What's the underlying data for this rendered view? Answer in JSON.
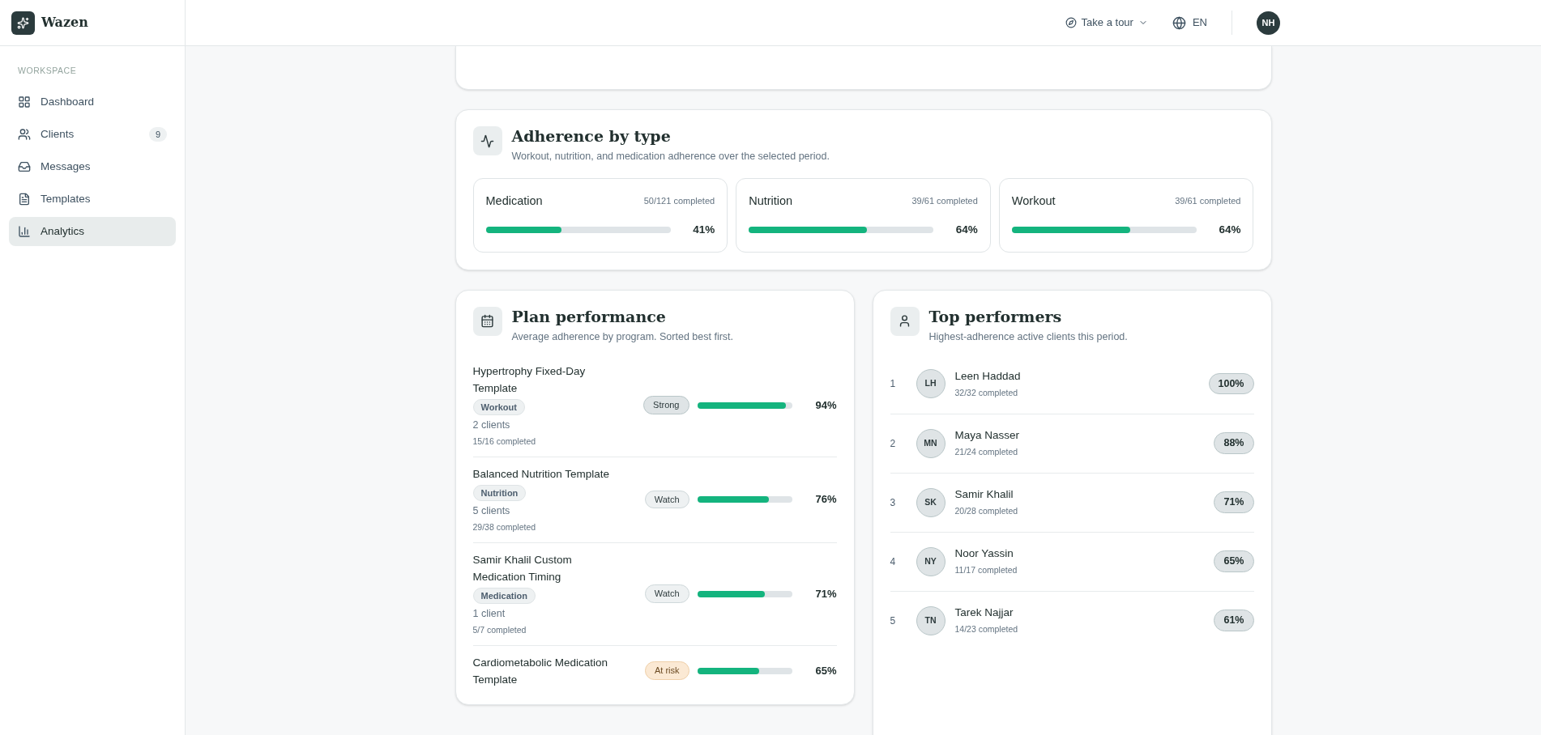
{
  "brand": {
    "name": "Wazen"
  },
  "header": {
    "tour": "Take a tour",
    "language": "EN",
    "avatar": "NH"
  },
  "sidebar": {
    "section": "WORKSPACE",
    "items": [
      {
        "label": "Dashboard",
        "selected": false
      },
      {
        "label": "Clients",
        "selected": false,
        "badge": "9"
      },
      {
        "label": "Messages",
        "selected": false
      },
      {
        "label": "Templates",
        "selected": false
      },
      {
        "label": "Analytics",
        "selected": true
      }
    ]
  },
  "adherence": {
    "title": "Adherence by type",
    "subtitle": "Workout, nutrition, and medication adherence over the selected period.",
    "items": [
      {
        "name": "Medication",
        "completed": "50/121 completed",
        "level": 0.41,
        "percent": "41%"
      },
      {
        "name": "Nutrition",
        "completed": "39/61 completed",
        "level": 0.64,
        "percent": "64%"
      },
      {
        "name": "Workout",
        "completed": "39/61 completed",
        "level": 0.64,
        "percent": "64%"
      }
    ]
  },
  "plan_performance": {
    "title": "Plan performance",
    "subtitle": "Average adherence by program. Sorted best first.",
    "rows": [
      {
        "name": "Hypertrophy Fixed-Day Template",
        "category": "Workout",
        "clients": "2 clients",
        "completed": "15/16 completed",
        "status": "Strong",
        "kind": "strong",
        "level": 0.94,
        "percent": "94%"
      },
      {
        "name": "Balanced Nutrition Template",
        "category": "Nutrition",
        "clients": "5 clients",
        "completed": "29/38 completed",
        "status": "Watch",
        "kind": "watch",
        "level": 0.76,
        "percent": "76%"
      },
      {
        "name": "Samir Khalil Custom Medication Timing",
        "category": "Medication",
        "clients": "1 client",
        "completed": "5/7 completed",
        "status": "Watch",
        "kind": "watch",
        "level": 0.71,
        "percent": "71%"
      },
      {
        "name": "Cardiometabolic Medication Template",
        "status": "At risk",
        "kind": "at_risk",
        "level": 0.65,
        "percent": "65%"
      }
    ]
  },
  "top_performers": {
    "title": "Top performers",
    "subtitle": "Highest-adherence active clients this period.",
    "rows": [
      {
        "rank": "1",
        "initials": "LH",
        "name": "Leen Haddad",
        "completed": "32/32 completed",
        "percent": "100%"
      },
      {
        "rank": "2",
        "initials": "MN",
        "name": "Maya Nasser",
        "completed": "21/24 completed",
        "percent": "88%"
      },
      {
        "rank": "3",
        "initials": "SK",
        "name": "Samir Khalil",
        "completed": "20/28 completed",
        "percent": "71%"
      },
      {
        "rank": "4",
        "initials": "NY",
        "name": "Noor Yassin",
        "completed": "11/17 completed",
        "percent": "65%"
      },
      {
        "rank": "5",
        "initials": "TN",
        "name": "Tarek Najjar",
        "completed": "14/23 completed",
        "percent": "61%"
      }
    ]
  }
}
